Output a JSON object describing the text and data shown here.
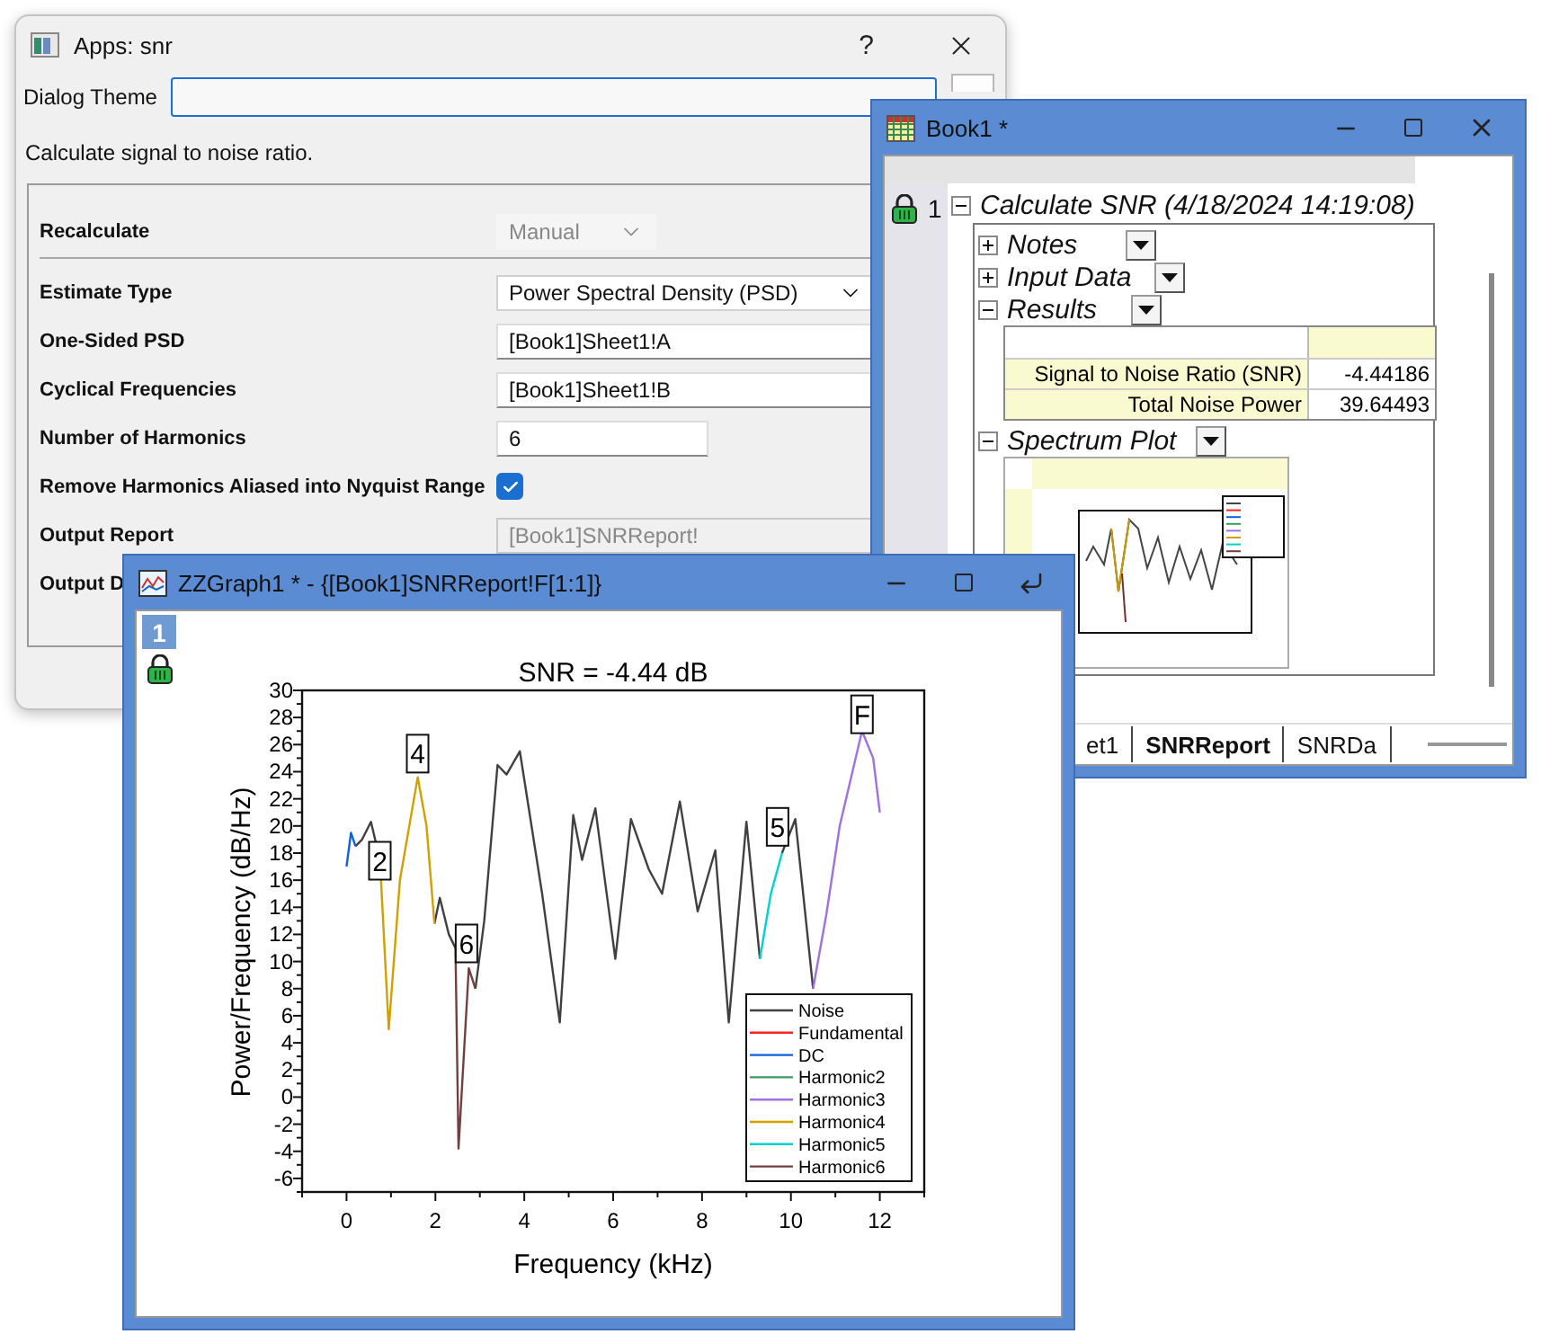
{
  "dialog": {
    "title": "Apps: snr",
    "help_button": "?",
    "theme_label": "Dialog Theme",
    "description": "Calculate signal to noise ratio.",
    "fields": [
      {
        "kind": "dropdown",
        "label": "Recalculate",
        "value": "Manual",
        "disabled": true
      },
      {
        "kind": "dropdown",
        "label": "Estimate Type",
        "value": "Power Spectral Density (PSD)",
        "disabled": false
      },
      {
        "kind": "input",
        "label": "One-Sided PSD",
        "value": "[Book1]Sheet1!A",
        "disabled": false
      },
      {
        "kind": "input",
        "label": "Cyclical Frequencies",
        "value": "[Book1]Sheet1!B",
        "disabled": false
      },
      {
        "kind": "number",
        "label": "Number of Harmonics",
        "value": "6",
        "disabled": false
      },
      {
        "kind": "checkbox",
        "label": "Remove Harmonics Aliased into Nyquist Range",
        "checked": true
      },
      {
        "kind": "input",
        "label": "Output Report",
        "value": "[Book1]SNRReport!",
        "disabled": true
      },
      {
        "kind": "label",
        "label": "Output D"
      }
    ]
  },
  "book": {
    "title": "Book1 *",
    "tree": {
      "index": "1",
      "title": "Calculate SNR (4/18/2024 14:19:08)",
      "expanded": true,
      "children": [
        {
          "kind": "section",
          "label": "Notes",
          "expanded": false
        },
        {
          "kind": "section",
          "label": "Input Data",
          "expanded": false
        },
        {
          "kind": "table",
          "label": "Results",
          "expanded": true,
          "rows": [
            {
              "label": "Signal to Noise Ratio (SNR)",
              "value": "-4.44186"
            },
            {
              "label": "Total Noise Power",
              "value": "39.64493"
            }
          ]
        },
        {
          "kind": "plot",
          "label": "Spectrum Plot",
          "expanded": true
        }
      ]
    },
    "sheet_tabs": [
      {
        "label": "et1",
        "selected": false
      },
      {
        "label": "SNRReport",
        "selected": true
      },
      {
        "label": "SNRDa",
        "selected": false
      }
    ]
  },
  "graph": {
    "title": "ZZGraph1 * - {[Book1]SNRReport!F[1:1]}",
    "layer": "1",
    "chart_data": {
      "type": "line",
      "title": "SNR = -4.44 dB",
      "xlabel": "Frequency (kHz)",
      "ylabel": "Power/Frequency (dB/Hz)",
      "x": [
        0,
        0.1,
        0.2,
        0.35,
        0.55,
        0.75,
        0.95,
        1.2,
        1.6,
        1.8,
        1.98,
        2.1,
        2.3,
        2.45,
        2.52,
        2.75,
        2.9,
        3.1,
        3.4,
        3.6,
        3.9,
        4.4,
        4.8,
        5.1,
        5.3,
        5.6,
        6.05,
        6.4,
        6.8,
        7.1,
        7.5,
        7.9,
        8.3,
        8.6,
        9.0,
        9.3,
        9.55,
        9.8,
        10.1,
        10.5,
        10.8,
        11.1,
        11.6,
        11.85,
        12
      ],
      "series": [
        {
          "name": "Noise",
          "color": "#404040",
          "values": [
            null,
            null,
            18.5,
            19,
            20.3,
            17.5,
            null,
            null,
            null,
            null,
            12.8,
            14.7,
            12,
            11,
            null,
            null,
            8,
            13,
            24.5,
            23.8,
            25.5,
            15,
            5.5,
            20.8,
            17.5,
            21.3,
            10.2,
            20.5,
            16.8,
            15,
            21.8,
            13.7,
            18.2,
            5.5,
            20.3,
            10.2,
            null,
            18,
            20.5,
            8,
            null,
            null,
            null,
            null,
            null
          ]
        },
        {
          "name": "Fundamental",
          "color": "#ff2020",
          "values": [
            null,
            null,
            null,
            null,
            null,
            null,
            null,
            null,
            null,
            null,
            null,
            null,
            null,
            null,
            null,
            null,
            null,
            null,
            null,
            null,
            null,
            null,
            null,
            null,
            null,
            null,
            null,
            null,
            null,
            null,
            null,
            null,
            null,
            null,
            null,
            null,
            null,
            null,
            null,
            null,
            null,
            null,
            null,
            null,
            null
          ]
        },
        {
          "name": "DC",
          "color": "#1060e0",
          "values": [
            17,
            19.5,
            18.5,
            null,
            null,
            null,
            null,
            null,
            null,
            null,
            null,
            null,
            null,
            null,
            null,
            null,
            null,
            null,
            null,
            null,
            null,
            null,
            null,
            null,
            null,
            null,
            null,
            null,
            null,
            null,
            null,
            null,
            null,
            null,
            null,
            null,
            null,
            null,
            null,
            null,
            null,
            null,
            null,
            null,
            null
          ]
        },
        {
          "name": "Harmonic2",
          "color": "#3a9a60",
          "values": [
            null,
            null,
            null,
            null,
            null,
            null,
            null,
            null,
            null,
            null,
            null,
            null,
            null,
            null,
            null,
            null,
            null,
            null,
            null,
            null,
            null,
            null,
            null,
            null,
            null,
            null,
            null,
            null,
            null,
            null,
            null,
            null,
            null,
            null,
            null,
            null,
            null,
            null,
            null,
            null,
            null,
            null,
            null,
            null,
            null
          ]
        },
        {
          "name": "Harmonic3",
          "color": "#a070e0",
          "values": [
            null,
            null,
            null,
            null,
            null,
            null,
            null,
            null,
            null,
            null,
            null,
            null,
            null,
            null,
            null,
            null,
            null,
            null,
            null,
            null,
            null,
            null,
            null,
            null,
            null,
            null,
            null,
            null,
            null,
            null,
            null,
            null,
            null,
            null,
            null,
            null,
            null,
            null,
            null,
            8,
            13.5,
            20,
            27,
            25,
            21
          ]
        },
        {
          "name": "Harmonic4",
          "color": "#d0a000",
          "values": [
            null,
            null,
            null,
            null,
            null,
            17.5,
            5,
            16,
            23.6,
            20,
            12.8,
            null,
            null,
            null,
            null,
            null,
            null,
            null,
            null,
            null,
            null,
            null,
            null,
            null,
            null,
            null,
            null,
            null,
            null,
            null,
            null,
            null,
            null,
            null,
            null,
            null,
            null,
            null,
            null,
            null,
            null,
            null,
            null,
            null,
            null
          ]
        },
        {
          "name": "Harmonic5",
          "color": "#00d0d0",
          "values": [
            null,
            null,
            null,
            null,
            null,
            null,
            null,
            null,
            null,
            null,
            null,
            null,
            null,
            null,
            null,
            null,
            null,
            null,
            null,
            null,
            null,
            null,
            null,
            null,
            null,
            null,
            null,
            null,
            null,
            null,
            null,
            null,
            null,
            null,
            null,
            10.2,
            15,
            18,
            null,
            null,
            null,
            null,
            null,
            null,
            null
          ]
        },
        {
          "name": "Harmonic6",
          "color": "#704040",
          "values": [
            null,
            null,
            null,
            null,
            null,
            null,
            null,
            null,
            null,
            null,
            null,
            null,
            null,
            11,
            -3.8,
            9.5,
            8,
            null,
            null,
            null,
            null,
            null,
            null,
            null,
            null,
            null,
            null,
            null,
            null,
            null,
            null,
            null,
            null,
            null,
            null,
            null,
            null,
            null,
            null,
            null,
            null,
            null,
            null,
            null,
            null
          ]
        }
      ],
      "xlim": [
        -1,
        13
      ],
      "ylim": [
        -7,
        30
      ],
      "xticks": [
        0,
        2,
        4,
        6,
        8,
        10,
        12
      ],
      "yticks": [
        -6,
        -4,
        -2,
        0,
        2,
        4,
        6,
        8,
        10,
        12,
        14,
        16,
        18,
        20,
        22,
        24,
        26,
        28,
        30
      ],
      "legend": "lower right",
      "annotations": [
        {
          "x": 0.75,
          "y": 17.5,
          "text": "2"
        },
        {
          "x": 1.6,
          "y": 25.4,
          "text": "4"
        },
        {
          "x": 2.7,
          "y": 11.4,
          "text": "6"
        },
        {
          "x": 9.7,
          "y": 20,
          "text": "5"
        },
        {
          "x": 11.6,
          "y": 28.3,
          "text": "F"
        }
      ]
    }
  }
}
